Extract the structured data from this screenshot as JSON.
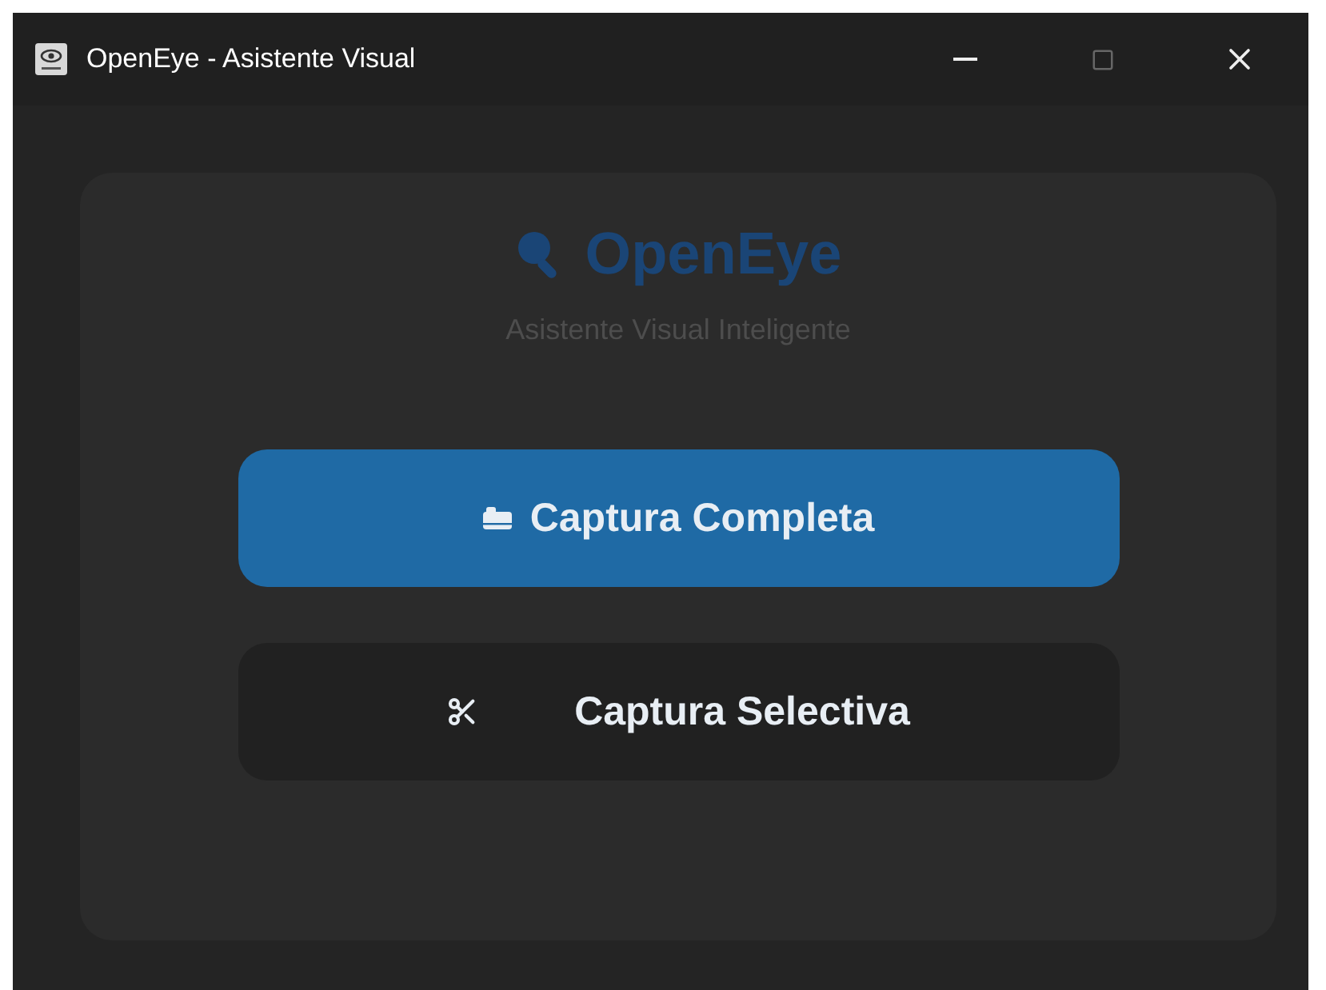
{
  "window": {
    "title": "OpenEye - Asistente Visual"
  },
  "header": {
    "title": "OpenEye",
    "subtitle": "Asistente Visual Inteligente"
  },
  "buttons": [
    {
      "label": "Captura Completa",
      "kind": "primary"
    },
    {
      "label": "Captura Selectiva",
      "kind": "secondary"
    }
  ]
}
